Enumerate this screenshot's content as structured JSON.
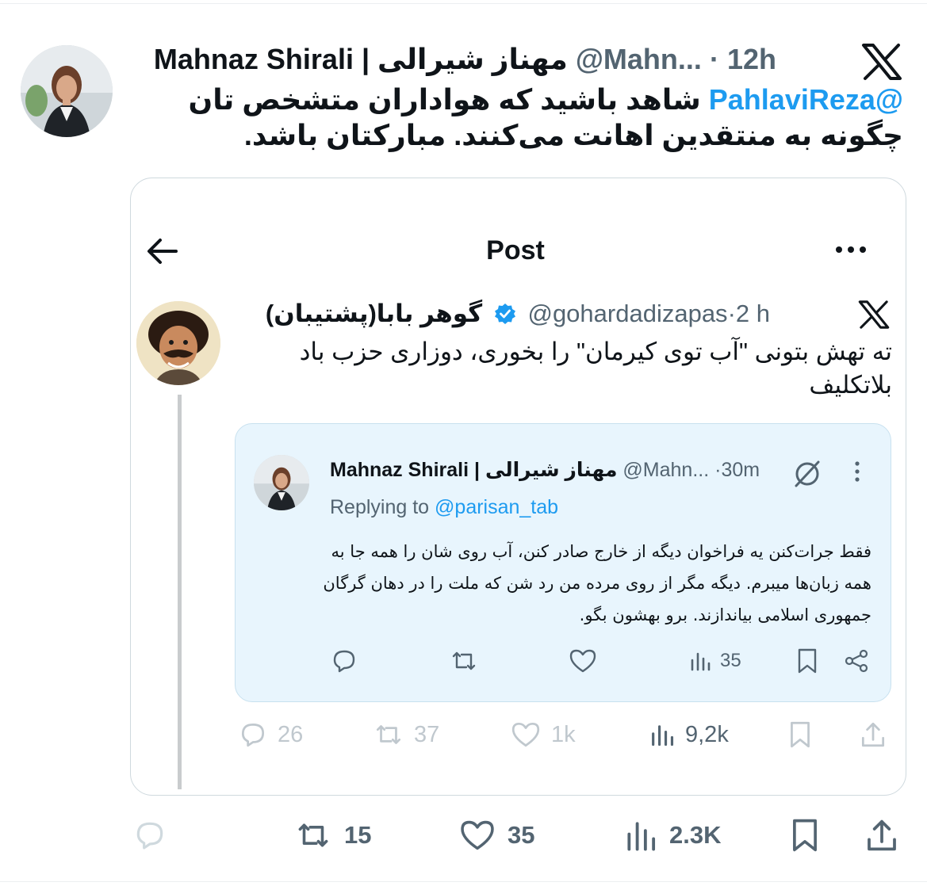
{
  "tweet": {
    "author_name": "Mahnaz Shirali | مهناز شیرالی",
    "handle": "@Mahn...",
    "separator": "·",
    "time": "12h",
    "mention": "@PahlaviReza",
    "text_line1": " شاهد باشید که هواداران متشخص تان",
    "text_line2": "چگونه به منتقدین اهانت می‌کنند. مبارکتان باشد.",
    "actions": {
      "reply": "",
      "retweets": "15",
      "likes": "35",
      "views": "2.3K"
    }
  },
  "embedded_screenshot": {
    "title": "Post",
    "inner_post": {
      "author_name": "گوهر بابا(پشتیبان)",
      "handle": "@gohardadizapas",
      "separator": "·",
      "time": "2 h",
      "text": "ته تهش بتونی \"آب توی کیرمان\" را بخوری، دوزاری حزب باد بلاتکلیف",
      "actions": {
        "replies": "26",
        "retweets": "37",
        "likes": "1k",
        "views": "9,2k"
      }
    },
    "quoted_post": {
      "author_name": "Mahnaz Shirali | مهناز شیرالی",
      "handle": "@Mahn...",
      "separator": "·",
      "time": "30m",
      "replying_label": "Replying to",
      "replying_to": "@parisan_tab",
      "text": "فقط جرات‌کنن یه فراخوان دیگه از خارج صادر کنن، آب روی شان را همه جا به همه زبان‌ها میبرم. دیگه مگر از روی مرده من رد شن که ملت را در دهان گرگان جمهوری اسلامی بیاندازند. برو بهشون بگو.",
      "actions": {
        "views": "35"
      }
    }
  },
  "colors": {
    "accent": "#1d9bf0",
    "text": "#0f1419",
    "muted": "#536471",
    "quote_bg": "#e8f5fd"
  }
}
